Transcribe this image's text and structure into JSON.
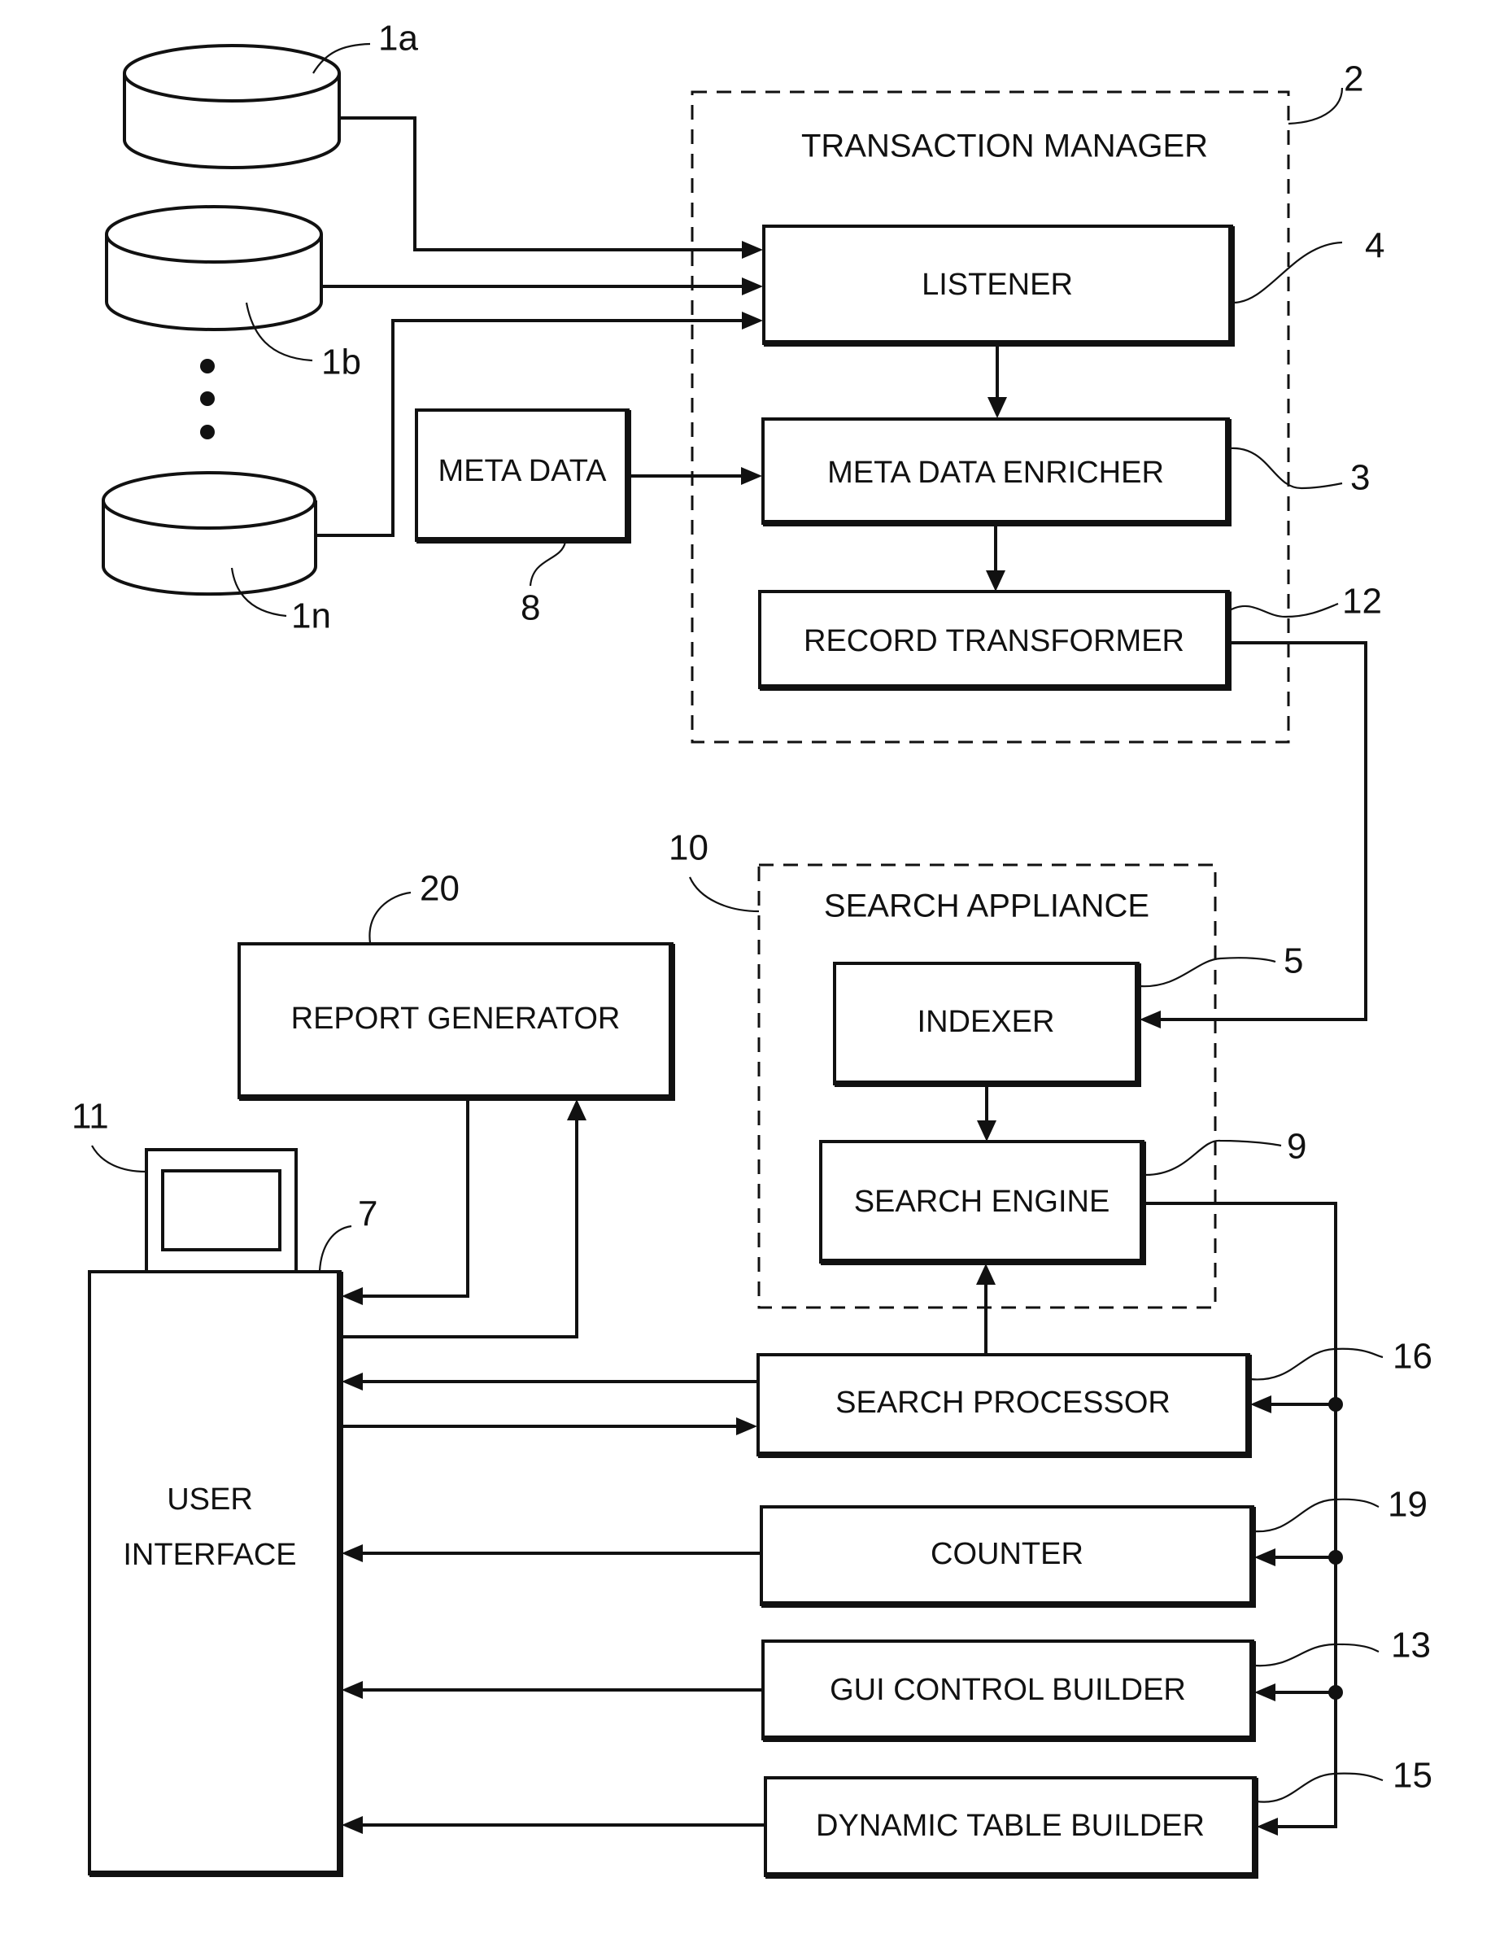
{
  "figure": {
    "transaction_manager": {
      "title": "TRANSACTION MANAGER",
      "ref": "2"
    },
    "search_appliance": {
      "title": "SEARCH APPLIANCE",
      "ref": "10"
    },
    "blocks": {
      "listener": {
        "label": "LISTENER",
        "ref": "4"
      },
      "meta_data_enricher": {
        "label": "META DATA ENRICHER",
        "ref": "3"
      },
      "record_transformer": {
        "label": "RECORD TRANSFORMER",
        "ref": "12"
      },
      "meta_data": {
        "label": "META DATA",
        "ref": "8"
      },
      "indexer": {
        "label": "INDEXER",
        "ref": "5"
      },
      "search_engine": {
        "label": "SEARCH ENGINE",
        "ref": "9"
      },
      "report_generator": {
        "label": "REPORT GENERATOR",
        "ref": "20"
      },
      "user_interface": {
        "label_line1": "USER",
        "label_line2": "INTERFACE",
        "ref": "7"
      },
      "display": {
        "ref": "11"
      },
      "search_processor": {
        "label": "SEARCH PROCESSOR",
        "ref": "16"
      },
      "counter": {
        "label": "COUNTER",
        "ref": "19"
      },
      "gui_control_builder": {
        "label": "GUI CONTROL BUILDER",
        "ref": "13"
      },
      "dynamic_table_builder": {
        "label": "DYNAMIC TABLE BUILDER",
        "ref": "15"
      }
    },
    "databases": [
      {
        "ref": "1a"
      },
      {
        "ref": "1b"
      },
      {
        "ref": "1n"
      }
    ],
    "connections": [
      {
        "from": "1a",
        "to": "LISTENER"
      },
      {
        "from": "1b",
        "to": "LISTENER"
      },
      {
        "from": "1n",
        "to": "LISTENER"
      },
      {
        "from": "LISTENER",
        "to": "META DATA ENRICHER"
      },
      {
        "from": "META DATA",
        "to": "META DATA ENRICHER"
      },
      {
        "from": "META DATA ENRICHER",
        "to": "RECORD TRANSFORMER"
      },
      {
        "from": "RECORD TRANSFORMER",
        "to": "INDEXER"
      },
      {
        "from": "INDEXER",
        "to": "SEARCH ENGINE"
      },
      {
        "from": "SEARCH PROCESSOR",
        "to": "SEARCH ENGINE"
      },
      {
        "from": "SEARCH ENGINE",
        "to": "SEARCH PROCESSOR"
      },
      {
        "from": "SEARCH ENGINE",
        "to": "COUNTER"
      },
      {
        "from": "SEARCH ENGINE",
        "to": "GUI CONTROL BUILDER"
      },
      {
        "from": "SEARCH ENGINE",
        "to": "DYNAMIC TABLE BUILDER"
      },
      {
        "from": "REPORT GENERATOR",
        "to": "USER INTERFACE"
      },
      {
        "from": "USER INTERFACE",
        "to": "REPORT GENERATOR"
      },
      {
        "from": "SEARCH PROCESSOR",
        "to": "USER INTERFACE"
      },
      {
        "from": "USER INTERFACE",
        "to": "SEARCH PROCESSOR"
      },
      {
        "from": "COUNTER",
        "to": "USER INTERFACE"
      },
      {
        "from": "GUI CONTROL BUILDER",
        "to": "USER INTERFACE"
      },
      {
        "from": "DYNAMIC TABLE BUILDER",
        "to": "USER INTERFACE"
      }
    ]
  }
}
